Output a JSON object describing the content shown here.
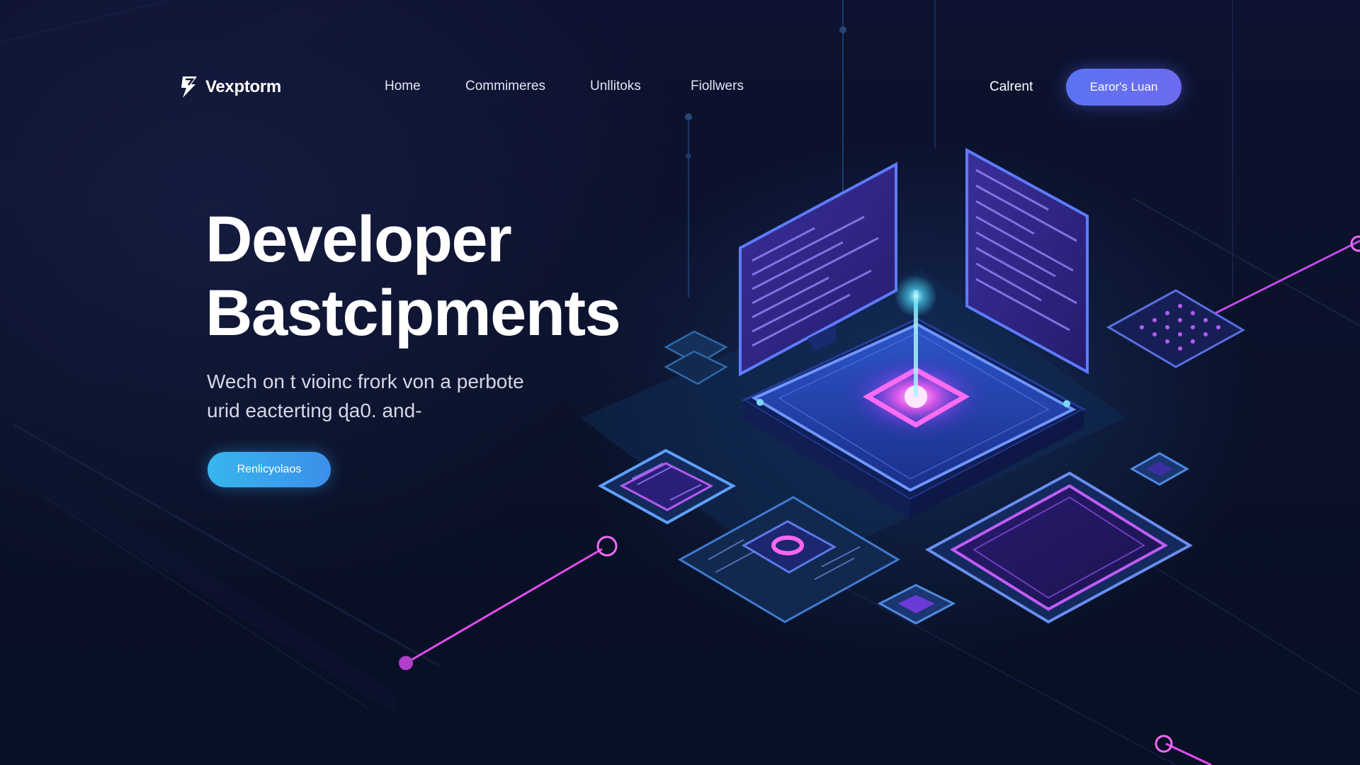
{
  "brand": {
    "name": "Vexptorm",
    "logo_icon": "lightning-bolt-logo-icon"
  },
  "nav": {
    "links": [
      "Home",
      "Commimeres",
      "Unllitoks",
      "Fiollwers"
    ],
    "signin_label": "Calrent",
    "cta_label": "Earor's Luan"
  },
  "hero": {
    "title_line1": "Developer",
    "title_line2": "Bastcipments",
    "subtitle_line1": "Wech on t vioinc frork von a perbote",
    "subtitle_line2": "urid eacterting ɖa0. and-",
    "cta_label": "Renlicyolaos"
  },
  "illustration": {
    "description_icon": "isometric-chip-circuit-illustration"
  },
  "colors": {
    "background": "#0b1027",
    "nav_cta": "#5b73f2",
    "hero_cta": "#38b6ee",
    "neon_magenta": "#e44cf2",
    "neon_blue": "#3f7df0",
    "accent_cyan": "#4ee0ff"
  }
}
